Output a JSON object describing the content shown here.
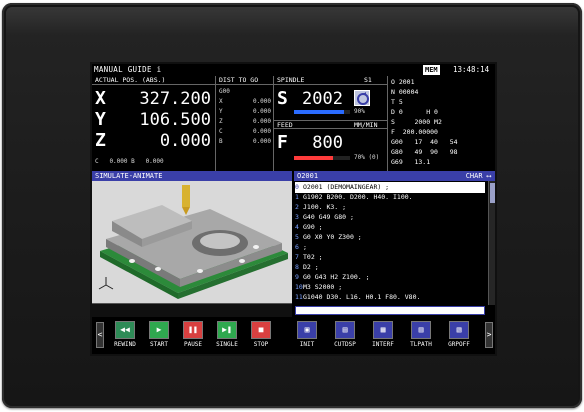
{
  "title_bar": {
    "title": "MANUAL GUIDE i",
    "mode_badge": "MEM",
    "clock": "13:48:14"
  },
  "position": {
    "header": "ACTUAL POS. (ABS.)",
    "axes": [
      {
        "label": "X",
        "value": "327.200"
      },
      {
        "label": "Y",
        "value": "106.500"
      },
      {
        "label": "Z",
        "value": "0.000"
      }
    ],
    "footer": "C   0.000 B   0.000"
  },
  "distance_to_go": {
    "header": "DIST TO GO",
    "code": "G00",
    "rows": [
      {
        "label": "X",
        "value": "0.000"
      },
      {
        "label": "Y",
        "value": "0.000"
      },
      {
        "label": "Z",
        "value": "0.000"
      },
      {
        "label": "C",
        "value": "0.000"
      },
      {
        "label": "B",
        "value": "0.000"
      }
    ]
  },
  "spindle": {
    "header": "SPINDLE",
    "channel": "S1",
    "s_label": "S",
    "s_value": "2002",
    "s_load": "90%",
    "s_load_fraction": 0.9,
    "feed_header": "FEED",
    "feed_unit": "MM/MIN",
    "f_label": "F",
    "f_value": "800",
    "f_override": "70% (0)",
    "f_load_fraction": 0.7
  },
  "modal": {
    "lines": [
      "O 2001",
      "N 00004",
      "T 5",
      "D 0      H 0",
      "S     2000 M2",
      "F  200.00000",
      "G00   17  40   54",
      "G80   49  90   98",
      "G69   13.1"
    ]
  },
  "simulation": {
    "title": "SIMULATE-ANIMATE"
  },
  "program": {
    "name": "O2001",
    "mode": "CHAR",
    "current_index": 0,
    "lines": [
      {
        "n": "0",
        "text": "O2001 (DEMOMAINGEAR) ;"
      },
      {
        "n": "1",
        "text": "G1902 B200. D200. H40. I100."
      },
      {
        "n": "2",
        "text": "J100. K3. ;"
      },
      {
        "n": "3",
        "text": "G40 G49 G80 ;"
      },
      {
        "n": "4",
        "text": "G90 ;"
      },
      {
        "n": "5",
        "text": "G0 X0 Y0 Z300 ;"
      },
      {
        "n": "6",
        "text": ";"
      },
      {
        "n": "7",
        "text": "T02 ;"
      },
      {
        "n": "8",
        "text": "D2 ;"
      },
      {
        "n": "9",
        "text": "G0 G43 H2 Z100. ;"
      },
      {
        "n": "10",
        "text": "M3 S2000 ;"
      },
      {
        "n": "11",
        "text": "G1040 D30. L16. H0.1 F80. V80."
      }
    ]
  },
  "softkeys": {
    "left_arrow": "<",
    "right_arrow": ">",
    "keys": [
      {
        "label": "REWIND",
        "icon": "rewind-icon",
        "color": "#2e8b57"
      },
      {
        "label": "START",
        "icon": "play-icon",
        "color": "#2fa84f"
      },
      {
        "label": "PAUSE",
        "icon": "pause-icon",
        "color": "#d84040"
      },
      {
        "label": "SINGLE",
        "icon": "single-step-icon",
        "color": "#2fa84f"
      },
      {
        "label": "STOP",
        "icon": "stop-icon",
        "color": "#d84040"
      },
      {
        "label": "INIT",
        "icon": "init-icon",
        "color": "#3a3fa8"
      },
      {
        "label": "CUTDSP",
        "icon": "cut-display-icon",
        "color": "#3a3fa8"
      },
      {
        "label": "INTERF",
        "icon": "interference-icon",
        "color": "#3a3fa8"
      },
      {
        "label": "TLPATH",
        "icon": "tool-path-icon",
        "color": "#3a3fa8"
      },
      {
        "label": "GRPOFF",
        "icon": "graphics-off-icon",
        "color": "#3a3fa8"
      }
    ]
  },
  "colors": {
    "title_blue": "#3a3fa8",
    "load_bar": "#2a6bff",
    "load_bar_warn": "#ff3b3b"
  }
}
